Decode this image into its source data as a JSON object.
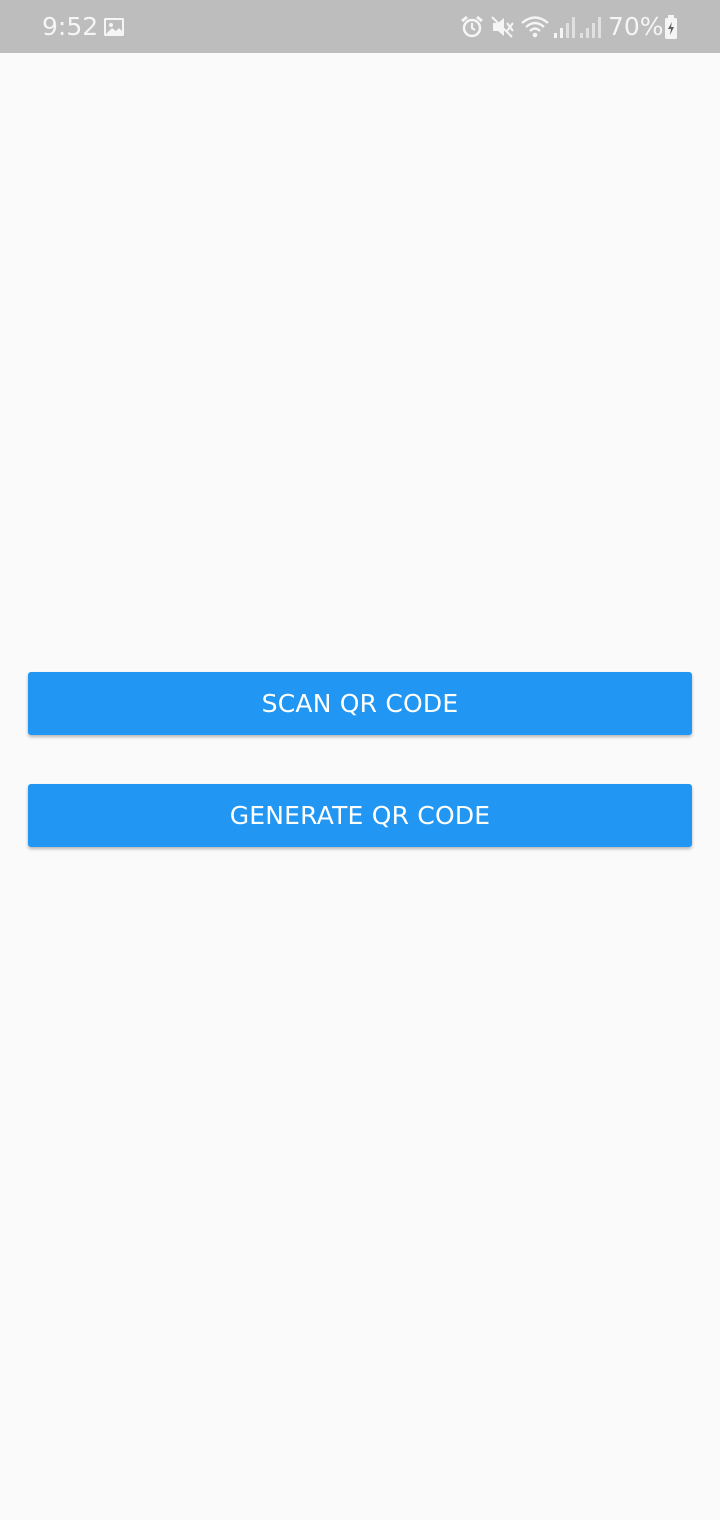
{
  "status_bar": {
    "time": "9:52",
    "battery_percent": "70%",
    "icons": [
      "gallery-icon",
      "alarm-icon",
      "mute-icon",
      "wifi-icon",
      "signal-icon",
      "signal-icon",
      "battery-icon"
    ],
    "background_color": "#bdbdbd"
  },
  "main": {
    "scan_button_label": "SCAN QR CODE",
    "generate_button_label": "GENERATE QR CODE",
    "button_color": "#2196f3"
  }
}
